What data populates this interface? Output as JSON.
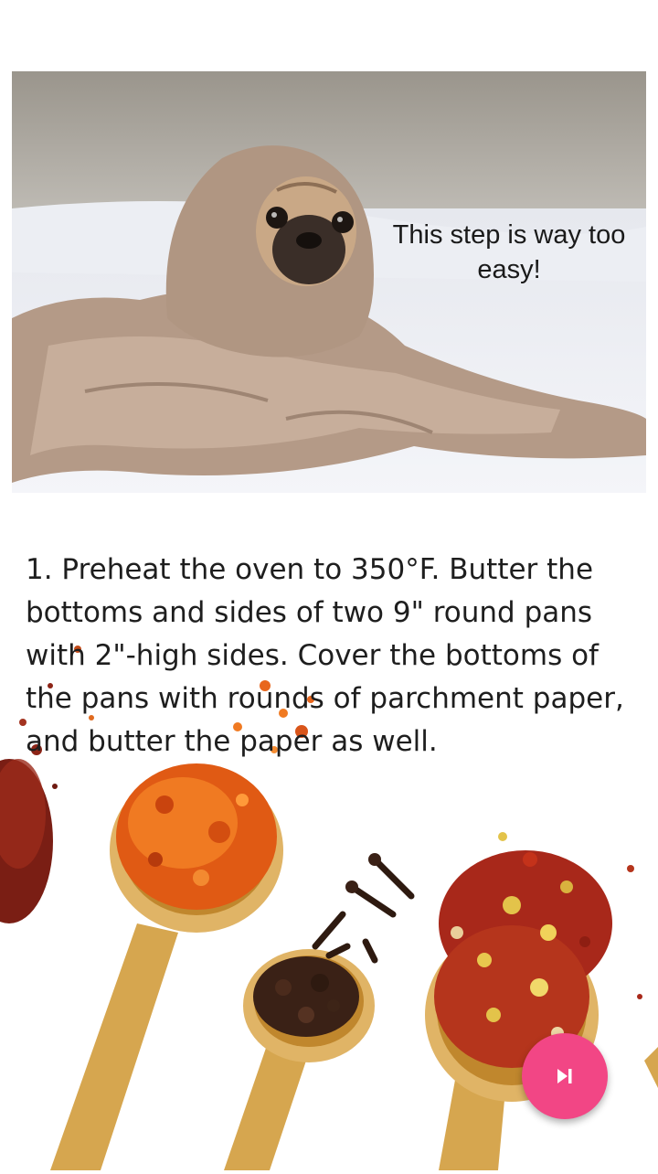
{
  "step_image": {
    "caption": "This step is way too easy!"
  },
  "instruction": {
    "text": "1. Preheat the oven to 350°F. Butter the bottoms and sides of two 9\" round pans with 2\"-high sides. Cover the bottoms of the pans with rounds of parchment paper, and butter the paper as well."
  },
  "fab": {
    "icon": "skip-next-icon",
    "color": "#f24685"
  }
}
